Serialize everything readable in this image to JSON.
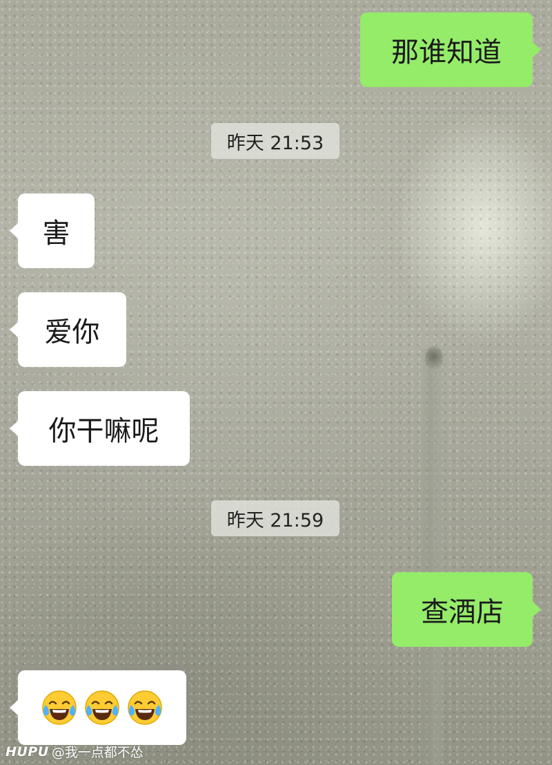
{
  "messages": [
    {
      "side": "right",
      "text": "那谁知道"
    },
    {
      "type": "timestamp",
      "text": "昨天 21:53"
    },
    {
      "side": "left",
      "text": "害"
    },
    {
      "side": "left",
      "text": "爱你"
    },
    {
      "side": "left",
      "text": "你干嘛呢"
    },
    {
      "type": "timestamp",
      "text": "昨天 21:59"
    },
    {
      "side": "right",
      "text": "查酒店"
    },
    {
      "side": "left",
      "emoji": [
        "tears-of-joy",
        "tears-of-joy",
        "tears-of-joy"
      ]
    }
  ],
  "watermark": {
    "logo": "HUPU",
    "handle": "@我一点都不怂"
  },
  "colors": {
    "sent_bubble": "#95ec69",
    "received_bubble": "#ffffff",
    "timestamp_bg": "#e1e2da"
  }
}
